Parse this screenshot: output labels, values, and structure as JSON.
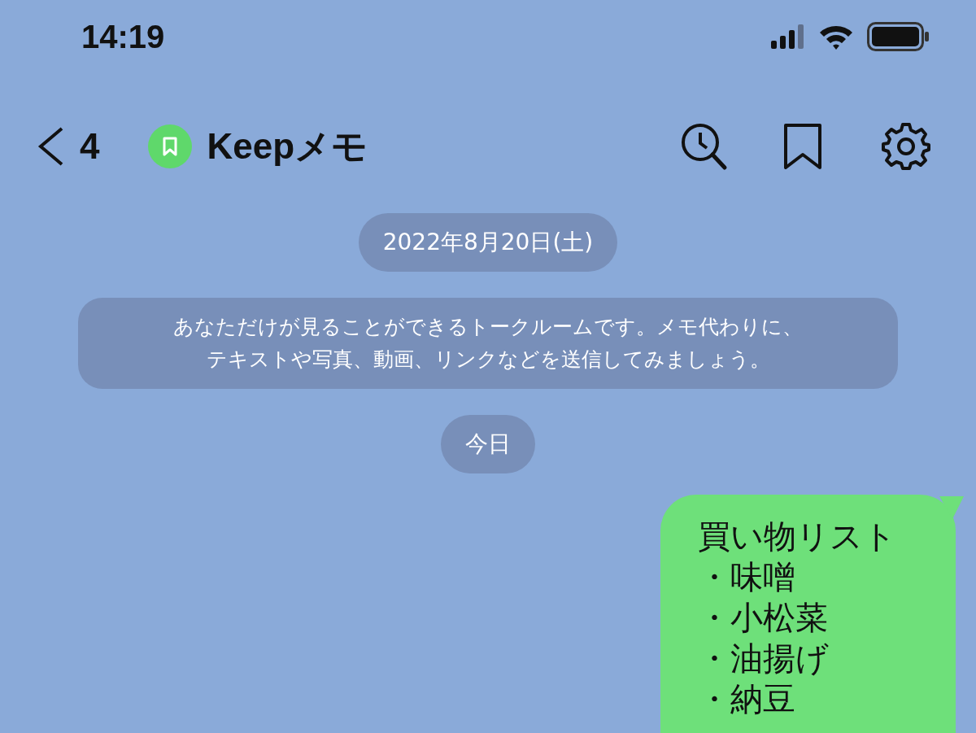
{
  "status_bar": {
    "time": "14:19"
  },
  "header": {
    "back_count": "4",
    "title": "Keepメモ"
  },
  "messages": [
    {
      "kind": "date",
      "text": "2022年8月20日(土)"
    },
    {
      "kind": "notice",
      "lines": [
        "あなただけが見ることができるトークルームです。メモ代わりに、",
        "テキストや写真、動画、リンクなどを送信してみましょう。"
      ]
    },
    {
      "kind": "date",
      "text": "今日"
    },
    {
      "kind": "outgoing",
      "lines": [
        "買い物リスト",
        "・味噌",
        "・小松菜",
        "・油揚げ",
        "・納豆"
      ]
    }
  ]
}
